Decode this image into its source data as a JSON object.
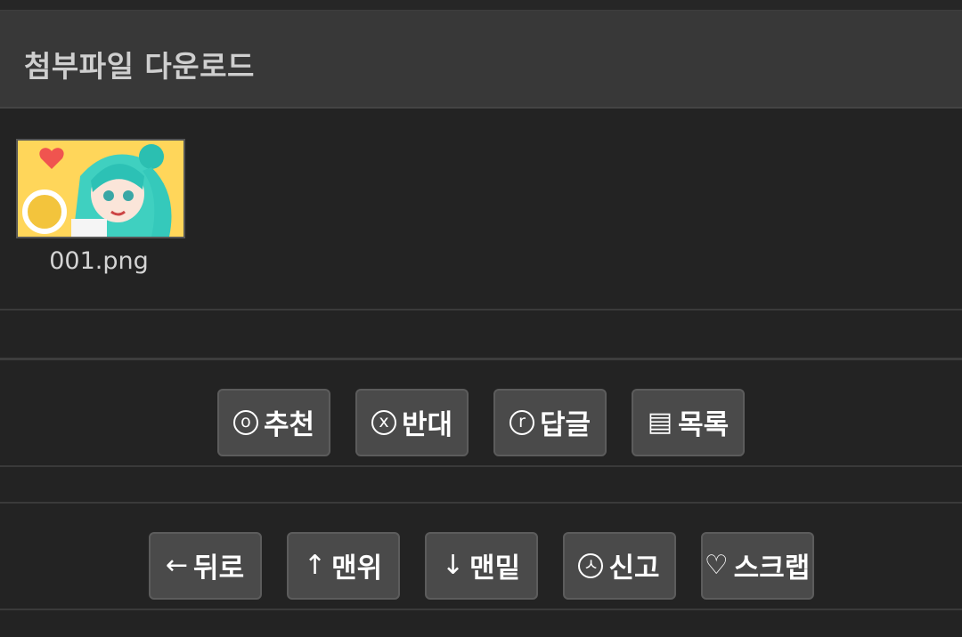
{
  "header": {
    "title": "첨부파일 다운로드"
  },
  "attachments": [
    {
      "file_name": "001.png"
    }
  ],
  "actions_row1": [
    {
      "icon": "o",
      "label": "추천"
    },
    {
      "icon": "x",
      "label": "반대"
    },
    {
      "icon": "r",
      "label": "답글"
    },
    {
      "icon": "▤",
      "label": "목록"
    }
  ],
  "actions_row2": [
    {
      "icon": "←",
      "label": "뒤로"
    },
    {
      "icon": "↑",
      "label": "맨위"
    },
    {
      "icon": "↓",
      "label": "맨밑"
    },
    {
      "icon": "ㅅ",
      "label": "신고"
    },
    {
      "icon": "♡",
      "label": "스크랩"
    }
  ]
}
